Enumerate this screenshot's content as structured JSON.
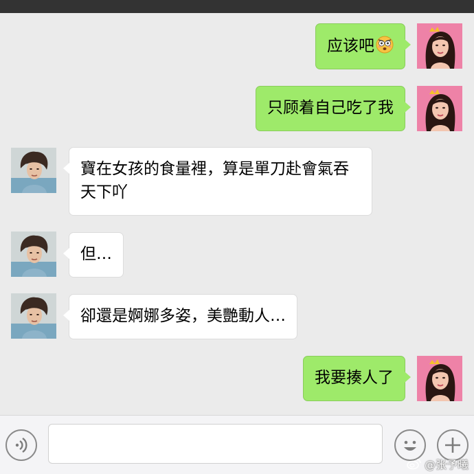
{
  "status_bar": {},
  "messages": [
    {
      "side": "right",
      "text": "应该吧",
      "emoji": "flushed-face-emoji"
    },
    {
      "side": "right",
      "text": "只顾着自己吃了我"
    },
    {
      "side": "left",
      "text": "寶在女孩的食量裡，算是單刀赴會氣吞天下吖"
    },
    {
      "side": "left",
      "text": "但…"
    },
    {
      "side": "left",
      "text": "卻還是婀娜多姿，美艷動人…"
    },
    {
      "side": "right",
      "text": "我要揍人了"
    }
  ],
  "input_bar": {
    "voice_icon": "voice-icon",
    "text_value": "",
    "emoji_icon": "smiley-icon",
    "plus_icon": "plus-icon"
  },
  "watermark": {
    "text": "@张予曦",
    "icon": "weibo-icon"
  },
  "colors": {
    "background": "#ebebeb",
    "bubble_right": "#9eea6a",
    "bubble_left": "#ffffff",
    "status_bar": "#333333"
  }
}
